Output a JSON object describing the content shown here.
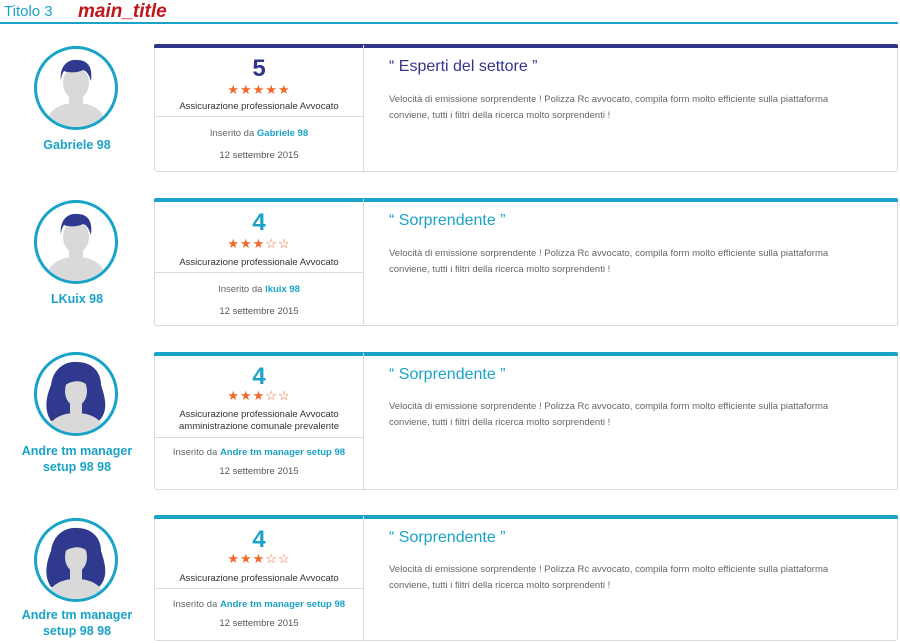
{
  "header": {
    "heading_label": "Titolo 3",
    "main_title": "main_title"
  },
  "colors": {
    "accent": "#1aa3c8",
    "navy": "#33358a",
    "star": "#f0682a",
    "brand_red": "#c0151b"
  },
  "reviews": [
    {
      "author": "Gabriele 98",
      "avatar": "male-avatar-icon",
      "rating": "5",
      "stars": "★★★★★",
      "rating_value": 5,
      "product": "Assicurazione professionale Avvocato",
      "inserted_label": "Inserito da",
      "inserted_by": "Gabriele 98",
      "date": "12 settembre 2015",
      "title": "“ Esperti del settore ”",
      "text": "Velocità di emissione sorprendente ! Polizza Rc avvocato, compila form molto efficiente sulla piattaforma conviene, tutti i filtri della ricerca molto sorprendenti !"
    },
    {
      "author": "LKuix 98",
      "avatar": "male-avatar-icon",
      "rating": "4",
      "stars": "★★★☆☆",
      "rating_value": 3,
      "product": "Assicurazione professionale Avvocato",
      "inserted_label": "Inserito da",
      "inserted_by": "lkuix 98",
      "date": "12 settembre 2015",
      "title": "“ Sorprendente ”",
      "text": "Velocità di emissione sorprendente ! Polizza Rc avvocato, compila form molto efficiente sulla piattaforma conviene, tutti i filtri della ricerca molto sorprendenti !"
    },
    {
      "author": "Andre tm manager setup 98 98",
      "avatar": "female-avatar-icon",
      "rating": "4",
      "stars": "★★★☆☆",
      "rating_value": 3,
      "product": "Assicurazione professionale Avvocato amministrazione comunale prevalente",
      "inserted_label": "Inserito da",
      "inserted_by": "Andre tm manager setup 98",
      "date": "12 settembre 2015",
      "title": "“ Sorprendente ”",
      "text": "Velocità di emissione sorprendente ! Polizza Rc avvocato, compila form molto efficiente sulla piattaforma conviene, tutti i filtri della ricerca molto sorprendenti !"
    },
    {
      "author": "Andre tm manager setup 98 98",
      "avatar": "female-avatar-icon",
      "rating": "4",
      "stars": "★★★☆☆",
      "rating_value": 3,
      "product": "Assicurazione professionale Avvocato",
      "inserted_label": "Inserito da",
      "inserted_by": "Andre tm manager setup 98",
      "date": "12 settembre 2015",
      "title": "“ Sorprendente ”",
      "text": "Velocità di emissione sorprendente ! Polizza Rc avvocato, compila form molto efficiente sulla piattaforma conviene, tutti i filtri della ricerca molto sorprendenti !"
    }
  ]
}
